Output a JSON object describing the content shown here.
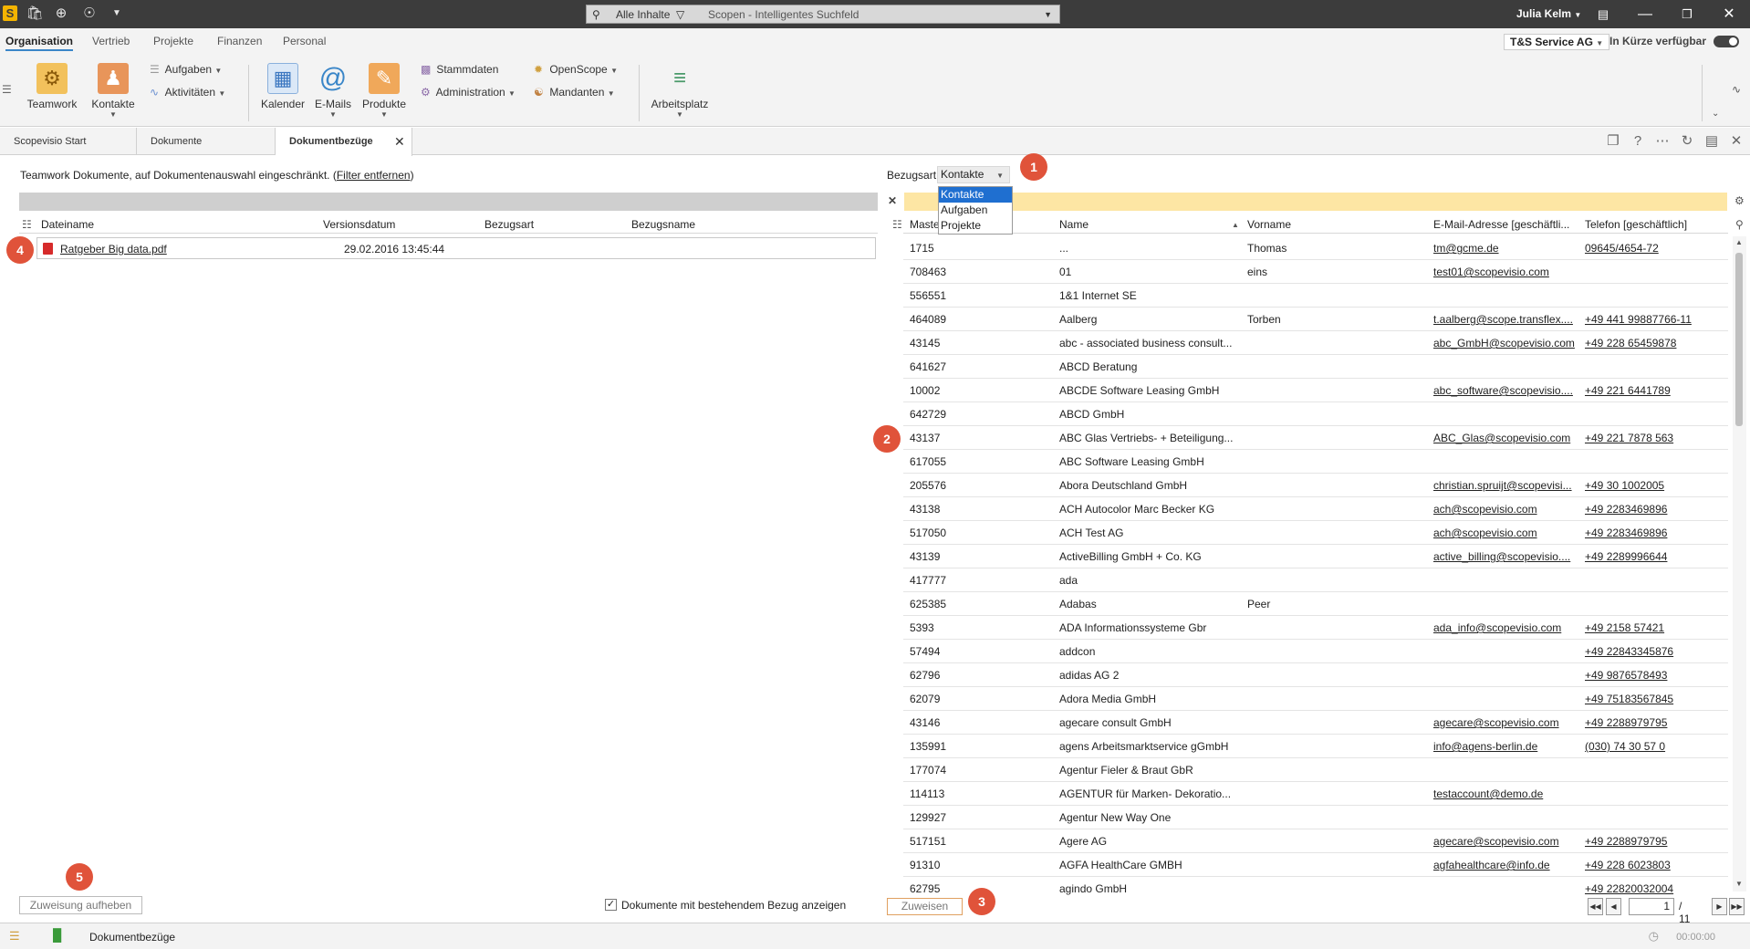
{
  "titlebar": {
    "search_scope": "Alle Inhalte",
    "search_placeholder": "Scopen - Intelligentes Suchfeld",
    "user": "Julia Kelm",
    "icons": [
      "app-logo-icon",
      "bag-icon",
      "plus-circle-icon",
      "life-ring-icon",
      "dropdown-icon"
    ]
  },
  "ribbon": {
    "tabs": [
      "Organisation",
      "Vertrieb",
      "Projekte",
      "Finanzen",
      "Personal"
    ],
    "active_tab": "Organisation",
    "company": "T&S Service AG",
    "availability": "In Kürze verfügbar",
    "buttons": {
      "teamwork": "Teamwork",
      "kontakte": "Kontakte",
      "aufgaben": "Aufgaben",
      "aktivitaeten": "Aktivitäten",
      "kalender": "Kalender",
      "emails": "E-Mails",
      "produkte": "Produkte",
      "stammdaten": "Stammdaten",
      "administration": "Administration",
      "openscope": "OpenScope",
      "mandanten": "Mandanten",
      "arbeitsplatz": "Arbeitsplatz"
    }
  },
  "doctabs": [
    {
      "label": "Scopevisio Start"
    },
    {
      "label": "Dokumente"
    },
    {
      "label": "Dokumentbezüge"
    }
  ],
  "left": {
    "filter_text": "Teamwork Dokumente, auf Dokumentenauswahl eingeschränkt. (",
    "filter_link": "Filter entfernen",
    "filter_close": ")",
    "columns": [
      "Dateiname",
      "Versionsdatum",
      "Bezugsart",
      "Bezugsname"
    ],
    "rows": [
      {
        "dateiname": "Ratgeber Big data.pdf",
        "versionsdatum": "29.02.2016 13:45:44",
        "bezugsart": "",
        "bezugsname": ""
      }
    ],
    "unassign_button": "Zuweisung aufheben",
    "checkbox_label": "Dokumente mit bestehendem Bezug anzeigen",
    "checkbox_checked": true
  },
  "right": {
    "bezugsart_label": "Bezugsart",
    "bezugsart_value": "Kontakte",
    "bezugsart_options": [
      "Kontakte",
      "Aufgaben",
      "Projekte"
    ],
    "columns": [
      "Maste",
      "Name",
      "Vorname",
      "E-Mail-Adresse [geschäftli...",
      "Telefon [geschäftlich]"
    ],
    "rows": [
      {
        "id": "1715",
        "name": "...",
        "vorname": "Thomas",
        "email": "tm@gcme.de",
        "tel": "09645/4654-72"
      },
      {
        "id": "708463",
        "name": "01",
        "vorname": "eins",
        "email": "test01@scopevisio.com",
        "tel": ""
      },
      {
        "id": "556551",
        "name": "1&1 Internet SE",
        "vorname": "",
        "email": "",
        "tel": ""
      },
      {
        "id": "464089",
        "name": "Aalberg",
        "vorname": "Torben",
        "email": "t.aalberg@scope.transflex....",
        "tel": "+49 441 99887766-11"
      },
      {
        "id": "43145",
        "name": "abc - associated business consult...",
        "vorname": "",
        "email": "abc_GmbH@scopevisio.com",
        "tel": "+49 228 65459878"
      },
      {
        "id": "641627",
        "name": "ABCD Beratung",
        "vorname": "",
        "email": "",
        "tel": ""
      },
      {
        "id": "10002",
        "name": "ABCDE Software Leasing GmbH",
        "vorname": "",
        "email": "abc_software@scopevisio....",
        "tel": "+49 221 6441789"
      },
      {
        "id": "642729",
        "name": "ABCD GmbH",
        "vorname": "",
        "email": "",
        "tel": ""
      },
      {
        "id": "43137",
        "name": "ABC Glas Vertriebs- + Beteiligung...",
        "vorname": "",
        "email": "ABC_Glas@scopevisio.com",
        "tel": "+49 221 7878 563"
      },
      {
        "id": "617055",
        "name": "ABC Software Leasing GmbH",
        "vorname": "",
        "email": "",
        "tel": ""
      },
      {
        "id": "205576",
        "name": "Abora Deutschland GmbH",
        "vorname": "",
        "email": "christian.spruijt@scopevisi...",
        "tel": "+49 30 1002005"
      },
      {
        "id": "43138",
        "name": "ACH Autocolor Marc Becker KG",
        "vorname": "",
        "email": "ach@scopevisio.com",
        "tel": "+49 2283469896"
      },
      {
        "id": "517050",
        "name": "ACH Test AG",
        "vorname": "",
        "email": "ach@scopevisio.com",
        "tel": "+49 2283469896"
      },
      {
        "id": "43139",
        "name": "ActiveBilling GmbH + Co. KG",
        "vorname": "",
        "email": "active_billing@scopevisio....",
        "tel": "+49 2289996644"
      },
      {
        "id": "417777",
        "name": "ada",
        "vorname": "",
        "email": "",
        "tel": ""
      },
      {
        "id": "625385",
        "name": "Adabas",
        "vorname": "Peer",
        "email": "",
        "tel": ""
      },
      {
        "id": "5393",
        "name": "ADA Informationssysteme Gbr",
        "vorname": "",
        "email": "ada_info@scopevisio.com",
        "tel": "+49 2158 57421"
      },
      {
        "id": "57494",
        "name": "addcon",
        "vorname": "",
        "email": "",
        "tel": "+49 22843345876"
      },
      {
        "id": "62796",
        "name": "adidas AG 2",
        "vorname": "",
        "email": "",
        "tel": "+49 9876578493"
      },
      {
        "id": "62079",
        "name": "Adora Media GmbH",
        "vorname": "",
        "email": "",
        "tel": "+49 75183567845"
      },
      {
        "id": "43146",
        "name": "agecare consult GmbH",
        "vorname": "",
        "email": "agecare@scopevisio.com",
        "tel": "+49 2288979795"
      },
      {
        "id": "135991",
        "name": "agens Arbeitsmarktservice gGmbH",
        "vorname": "",
        "email": "info@agens-berlin.de",
        "tel": "(030) 74 30 57 0"
      },
      {
        "id": "177074",
        "name": "Agentur Fieler & Braut GbR",
        "vorname": "",
        "email": "",
        "tel": ""
      },
      {
        "id": "114113",
        "name": "AGENTUR für Marken- Dekoratio...",
        "vorname": "",
        "email": "testaccount@demo.de",
        "tel": ""
      },
      {
        "id": "129927",
        "name": "Agentur New Way One",
        "vorname": "",
        "email": "",
        "tel": ""
      },
      {
        "id": "517151",
        "name": "Agere AG",
        "vorname": "",
        "email": "agecare@scopevisio.com",
        "tel": "+49 2288979795"
      },
      {
        "id": "91310",
        "name": "AGFA HealthCare GMBH",
        "vorname": "",
        "email": "agfahealthcare@info.de",
        "tel": "+49 228 6023803"
      },
      {
        "id": "62795",
        "name": "agindo GmbH",
        "vorname": "",
        "email": "",
        "tel": "+49 22820032004"
      }
    ],
    "assign_button": "Zuweisen",
    "pager": {
      "page": "1",
      "total": "/ 11"
    }
  },
  "statusbar": {
    "label": "Dokumentbezüge",
    "timer": "00:00:00"
  },
  "badges": [
    "1",
    "2",
    "3",
    "4",
    "5"
  ],
  "colors": {
    "accent": "#3a86c8",
    "badge": "#e0533a",
    "highlight": "#fde6a4",
    "selection": "#1f6fd0"
  }
}
